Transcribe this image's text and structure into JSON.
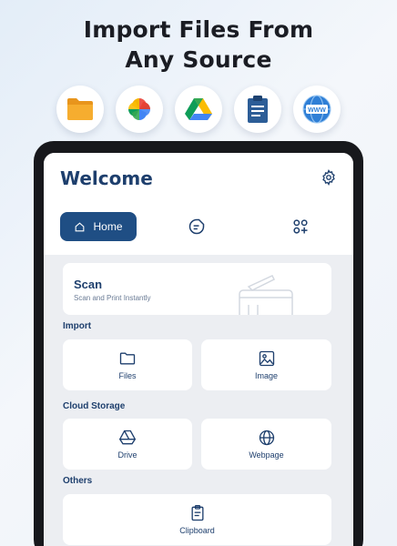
{
  "headline": {
    "line1": "Import Files From",
    "line2": "Any Source"
  },
  "sources": [
    {
      "icon": "folder-icon"
    },
    {
      "icon": "google-photos-icon"
    },
    {
      "icon": "google-drive-icon"
    },
    {
      "icon": "clipboard-icon"
    },
    {
      "icon": "web-icon",
      "text": "WWW"
    }
  ],
  "app": {
    "title": "Welcome",
    "nav": {
      "home_label": "Home"
    },
    "scan": {
      "title": "Scan",
      "subtitle": "Scan and Print Instantly"
    },
    "sections": {
      "import": "Import",
      "cloud": "Cloud Storage",
      "others": "Others"
    },
    "tiles": {
      "files": "Files",
      "image": "Image",
      "drive": "Drive",
      "webpage": "Webpage",
      "clipboard": "Clipboard"
    }
  },
  "colors": {
    "accent": "#1f4e84",
    "text": "#1e3f6d",
    "screen_bg": "#eceef2"
  }
}
